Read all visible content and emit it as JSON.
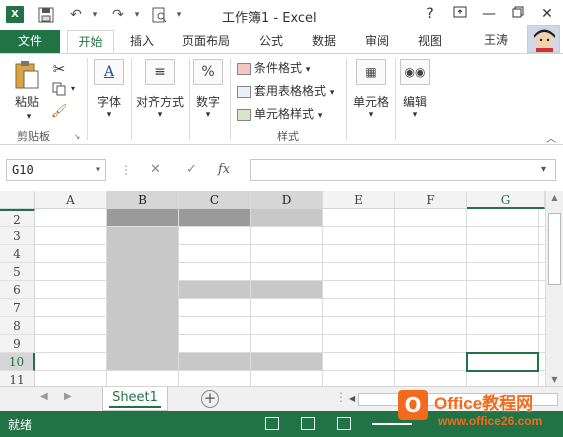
{
  "titlebar": {
    "app_badge": "X",
    "title": "工作簿1 - Excel",
    "help": "?",
    "minimize": "—",
    "close": "✕"
  },
  "tabs": [
    {
      "label": "文件"
    },
    {
      "label": "开始"
    },
    {
      "label": "插入"
    },
    {
      "label": "页面布局"
    },
    {
      "label": "公式"
    },
    {
      "label": "数据"
    },
    {
      "label": "审阅"
    },
    {
      "label": "视图"
    }
  ],
  "user": {
    "name": "王涛"
  },
  "ribbon": {
    "paste": "粘贴",
    "clipboard_group": "剪贴板",
    "font": "字体",
    "alignment": "对齐方式",
    "number": "数字",
    "conditional_format": "条件格式",
    "table_format": "套用表格格式",
    "cell_styles": "单元格样式",
    "styles_group": "样式",
    "cells": "单元格",
    "editing": "编辑"
  },
  "formula_bar": {
    "name_box": "G10",
    "fx": "fx",
    "value": ""
  },
  "grid": {
    "columns": [
      "A",
      "B",
      "C",
      "D",
      "E",
      "F",
      "G"
    ],
    "rows": [
      "2",
      "3",
      "4",
      "5",
      "6",
      "7",
      "8",
      "9",
      "10",
      "11"
    ],
    "active_cell": "G10",
    "selected_column": "G",
    "selected_row": "10"
  },
  "sheets": [
    {
      "name": "Sheet1",
      "active": true
    }
  ],
  "status": {
    "ready": "就绪"
  },
  "watermark": {
    "line1": "Office教程网",
    "line2": "www.office26.com"
  },
  "colors": {
    "accent": "#217346",
    "shade": "#c8c8c8",
    "shade_dark": "#9a9a9a"
  }
}
